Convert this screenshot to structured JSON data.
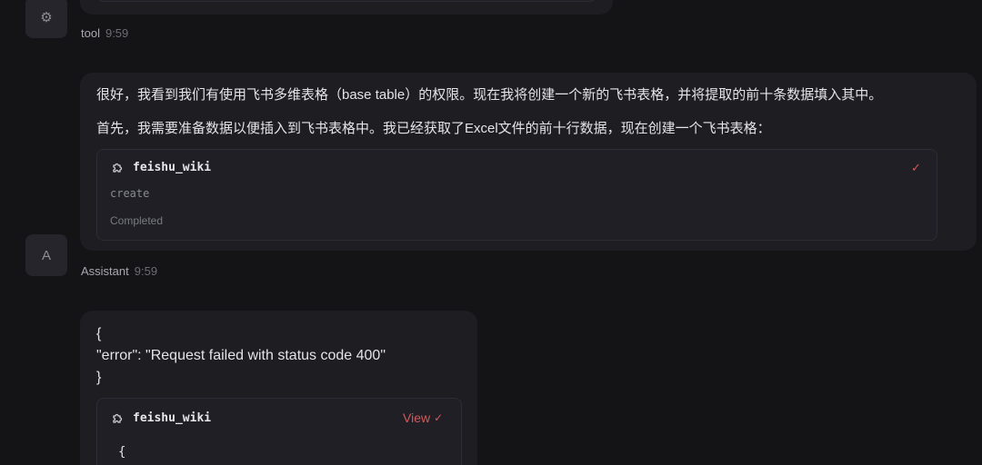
{
  "top": {
    "avatar_icon": "gear-icon",
    "avatar_glyph": "⚙",
    "sender": "tool",
    "time": "9:59"
  },
  "assistant_message": {
    "line1": "很好，我看到我们有使用飞书多维表格（base table）的权限。现在我将创建一个新的飞书表格，并将提取的前十条数据填入其中。",
    "line2": "首先，我需要准备数据以便插入到飞书表格中。我已经获取了Excel文件的前十行数据，现在创建一个飞书表格：",
    "tool_call": {
      "icon": "puzzle-icon",
      "name": "feishu_wiki",
      "action": "create",
      "status": "Completed",
      "check": "✓"
    },
    "avatar_letter": "A",
    "sender": "Assistant",
    "time": "9:59"
  },
  "tool_result": {
    "line1": "{",
    "line2": "\"error\": \"Request failed with status code 400\"",
    "line3": "}",
    "tool_call": {
      "icon": "puzzle-icon",
      "name": "feishu_wiki",
      "view_label": "View",
      "check": "✓",
      "preview": "{"
    }
  },
  "colors": {
    "background": "#141417",
    "bubble": "#1d1d22",
    "accent": "#d35a5a"
  }
}
